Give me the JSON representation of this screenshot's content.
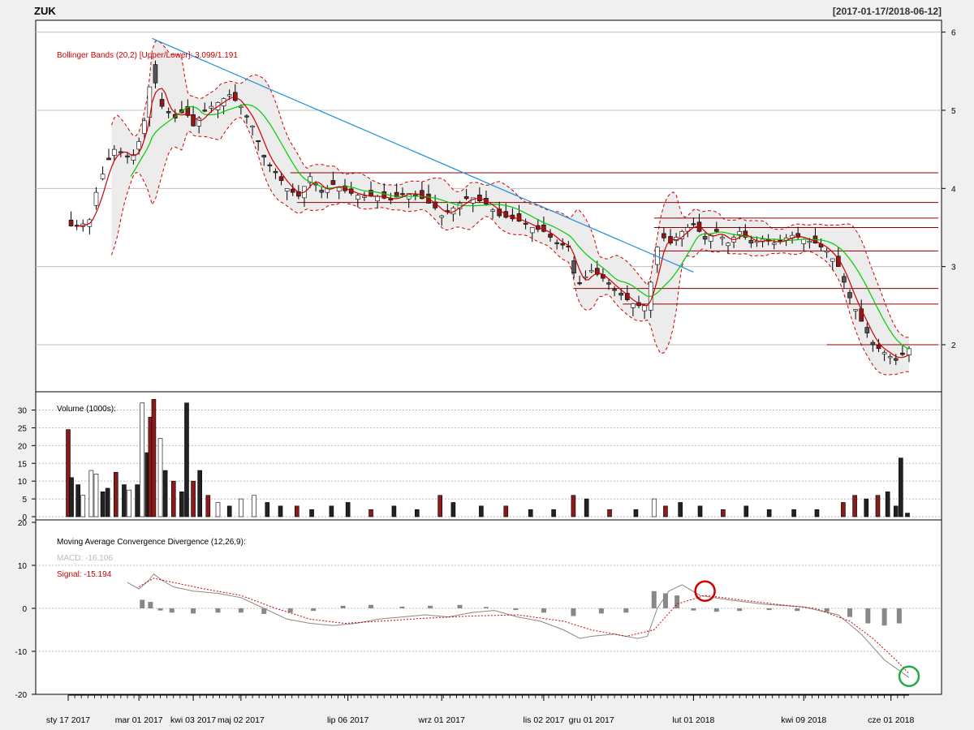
{
  "header": {
    "symbol": "ZUK",
    "date_range": "[2017-01-17/2018-06-12]"
  },
  "colors": {
    "background": "#f0f0f0",
    "panel_bg": "#ffffff",
    "border": "#000000",
    "grid": "#bfbfbf",
    "up": "#ffffff",
    "down": "#8b1a1a",
    "neutral": "#555555",
    "bband_fill": "#ececec",
    "bband_line": "#cc0000",
    "ma_fast": "#cc0000",
    "ma_slow": "#00cc00",
    "trendline": "#1e90d8",
    "support_line": "#8b0000",
    "macd_line": "#888888",
    "signal_line": "#cc0000",
    "circle_sell": "#cc0000",
    "circle_buy": "#22aa44"
  },
  "chart_data": [
    {
      "type": "candlestick",
      "panel": "price",
      "annotation": "Bollinger Bands (20,2) [Upper/Lower]: 3.099/1.191",
      "ylim": [
        1.45,
        6.1
      ],
      "yticks": [
        2,
        3,
        4,
        5,
        6
      ],
      "grid": true,
      "x_range": [
        "2017-01-17",
        "2018-06-12"
      ],
      "x_tick_labels": [
        "sty 17 2017",
        "mar 01 2017",
        "kwi 03 2017",
        "maj 02 2017",
        "lip 06 2017",
        "wrz 01 2017",
        "lis 02 2017",
        "gru 01 2017",
        "lut 01 2018",
        "kwi 09 2018",
        "cze 01 2018"
      ],
      "x_tick_dates": [
        "2017-01-17",
        "2017-03-01",
        "2017-04-03",
        "2017-05-02",
        "2017-07-06",
        "2017-09-01",
        "2017-11-02",
        "2017-12-01",
        "2018-02-01",
        "2018-04-09",
        "2018-06-01"
      ],
      "close_path": [
        [
          "2017-01-17",
          3.52
        ],
        [
          "2017-01-24",
          3.52
        ],
        [
          "2017-01-30",
          3.6
        ],
        [
          "2017-02-03",
          3.95
        ],
        [
          "2017-02-09",
          4.3
        ],
        [
          "2017-02-14",
          4.5
        ],
        [
          "2017-02-20",
          4.45
        ],
        [
          "2017-02-24",
          4.35
        ],
        [
          "2017-03-01",
          4.6
        ],
        [
          "2017-03-06",
          5.0
        ],
        [
          "2017-03-09",
          5.6
        ],
        [
          "2017-03-13",
          5.1
        ],
        [
          "2017-03-17",
          5.0
        ],
        [
          "2017-03-23",
          4.9
        ],
        [
          "2017-03-29",
          5.0
        ],
        [
          "2017-04-03",
          4.8
        ],
        [
          "2017-04-10",
          5.0
        ],
        [
          "2017-04-18",
          5.1
        ],
        [
          "2017-04-25",
          5.2
        ],
        [
          "2017-05-02",
          5.05
        ],
        [
          "2017-05-09",
          4.8
        ],
        [
          "2017-05-16",
          4.4
        ],
        [
          "2017-05-23",
          4.2
        ],
        [
          "2017-05-30",
          4.0
        ],
        [
          "2017-06-06",
          3.9
        ],
        [
          "2017-06-13",
          4.15
        ],
        [
          "2017-06-20",
          3.95
        ],
        [
          "2017-06-27",
          4.05
        ],
        [
          "2017-07-06",
          3.95
        ],
        [
          "2017-07-14",
          3.9
        ],
        [
          "2017-07-24",
          3.9
        ],
        [
          "2017-08-01",
          3.85
        ],
        [
          "2017-08-10",
          3.95
        ],
        [
          "2017-08-18",
          3.9
        ],
        [
          "2017-08-28",
          3.75
        ],
        [
          "2017-09-01",
          3.65
        ],
        [
          "2017-09-08",
          3.75
        ],
        [
          "2017-09-18",
          3.9
        ],
        [
          "2017-09-28",
          3.8
        ],
        [
          "2017-10-06",
          3.65
        ],
        [
          "2017-10-16",
          3.6
        ],
        [
          "2017-10-26",
          3.5
        ],
        [
          "2017-11-02",
          3.45
        ],
        [
          "2017-11-10",
          3.3
        ],
        [
          "2017-11-17",
          3.25
        ],
        [
          "2017-11-22",
          2.75
        ],
        [
          "2017-12-01",
          2.95
        ],
        [
          "2017-12-08",
          2.85
        ],
        [
          "2017-12-15",
          2.7
        ],
        [
          "2017-12-21",
          2.6
        ],
        [
          "2017-12-28",
          2.5
        ],
        [
          "2018-01-04",
          2.5
        ],
        [
          "2018-01-08",
          3.1
        ],
        [
          "2018-01-12",
          3.4
        ],
        [
          "2018-01-18",
          3.3
        ],
        [
          "2018-01-25",
          3.45
        ],
        [
          "2018-02-01",
          3.55
        ],
        [
          "2018-02-08",
          3.35
        ],
        [
          "2018-02-15",
          3.45
        ],
        [
          "2018-02-22",
          3.3
        ],
        [
          "2018-03-01",
          3.45
        ],
        [
          "2018-03-08",
          3.3
        ],
        [
          "2018-03-15",
          3.35
        ],
        [
          "2018-03-22",
          3.3
        ],
        [
          "2018-04-02",
          3.4
        ],
        [
          "2018-04-09",
          3.35
        ],
        [
          "2018-04-16",
          3.3
        ],
        [
          "2018-04-23",
          3.2
        ],
        [
          "2018-04-30",
          3.0
        ],
        [
          "2018-05-07",
          2.6
        ],
        [
          "2018-05-14",
          2.3
        ],
        [
          "2018-05-21",
          2.0
        ],
        [
          "2018-05-28",
          1.9
        ],
        [
          "2018-06-04",
          1.8
        ],
        [
          "2018-06-12",
          1.95
        ]
      ],
      "resistance_support_levels": [
        {
          "value": 4.2,
          "from": "2017-06-01",
          "to": "2018-06-12"
        },
        {
          "value": 3.82,
          "from": "2017-06-05",
          "to": "2018-06-12"
        },
        {
          "value": 3.62,
          "from": "2018-01-08",
          "to": "2018-06-12"
        },
        {
          "value": 3.5,
          "from": "2018-01-08",
          "to": "2018-06-12"
        },
        {
          "value": 3.2,
          "from": "2018-01-08",
          "to": "2018-06-12"
        },
        {
          "value": 2.72,
          "from": "2017-11-20",
          "to": "2018-06-12"
        },
        {
          "value": 2.52,
          "from": "2017-12-20",
          "to": "2018-06-12"
        },
        {
          "value": 2.0,
          "from": "2018-04-23",
          "to": "2018-06-12"
        }
      ],
      "trendline": {
        "from": [
          "2017-03-09",
          5.92
        ],
        "to": [
          "2018-02-01",
          2.93
        ]
      }
    },
    {
      "type": "bar",
      "panel": "volume",
      "annotation": "Volume (1000s):",
      "ylim": [
        0,
        34
      ],
      "yticks": [
        0,
        5,
        10,
        15,
        20,
        25,
        30
      ],
      "grid": true,
      "x": [
        "2017-01-17",
        "2017-01-19",
        "2017-01-23",
        "2017-01-26",
        "2017-01-31",
        "2017-02-03",
        "2017-02-07",
        "2017-02-10",
        "2017-02-15",
        "2017-02-20",
        "2017-02-23",
        "2017-02-28",
        "2017-03-03",
        "2017-03-06",
        "2017-03-08",
        "2017-03-10",
        "2017-03-14",
        "2017-03-17",
        "2017-03-22",
        "2017-03-27",
        "2017-03-30",
        "2017-04-03",
        "2017-04-07",
        "2017-04-12",
        "2017-04-18",
        "2017-04-25",
        "2017-05-02",
        "2017-05-10",
        "2017-05-18",
        "2017-05-26",
        "2017-06-05",
        "2017-06-14",
        "2017-06-26",
        "2017-07-06",
        "2017-07-20",
        "2017-08-03",
        "2017-08-17",
        "2017-08-31",
        "2017-09-08",
        "2017-09-25",
        "2017-10-10",
        "2017-10-25",
        "2017-11-08",
        "2017-11-20",
        "2017-11-28",
        "2017-12-12",
        "2017-12-28",
        "2018-01-08",
        "2018-01-15",
        "2018-01-24",
        "2018-02-05",
        "2018-02-19",
        "2018-03-05",
        "2018-03-19",
        "2018-04-03",
        "2018-04-17",
        "2018-05-03",
        "2018-05-10",
        "2018-05-17",
        "2018-05-24",
        "2018-05-30",
        "2018-06-04",
        "2018-06-07",
        "2018-06-11"
      ],
      "values": [
        24.5,
        11,
        9,
        6,
        13,
        12,
        7,
        8,
        12.5,
        9,
        7.5,
        9,
        32,
        18,
        28,
        33,
        22,
        13,
        10,
        7,
        32,
        10,
        13,
        6,
        4,
        3,
        5,
        6,
        4,
        3,
        3,
        2,
        3,
        4,
        2,
        3,
        2,
        6,
        4,
        3,
        3,
        2,
        2,
        6,
        5,
        2,
        2,
        5,
        3,
        4,
        3,
        2,
        3,
        2,
        2,
        2,
        4,
        6,
        5,
        6,
        7,
        3,
        16.5,
        1
      ],
      "colors": [
        "down",
        "neutral",
        "neutral",
        "up",
        "up",
        "up",
        "neutral",
        "neutral",
        "down",
        "neutral",
        "up",
        "neutral",
        "up",
        "neutral",
        "down",
        "down",
        "up",
        "neutral",
        "down",
        "neutral",
        "neutral",
        "down",
        "neutral",
        "down",
        "up",
        "neutral",
        "up",
        "up",
        "neutral",
        "neutral",
        "down",
        "neutral",
        "neutral",
        "neutral",
        "down",
        "neutral",
        "neutral",
        "down",
        "neutral",
        "neutral",
        "down",
        "neutral",
        "neutral",
        "down",
        "neutral",
        "down",
        "neutral",
        "up",
        "down",
        "neutral",
        "neutral",
        "down",
        "neutral",
        "neutral",
        "neutral",
        "neutral",
        "down",
        "down",
        "neutral",
        "down",
        "neutral",
        "neutral",
        "neutral",
        "neutral"
      ]
    },
    {
      "type": "line",
      "panel": "macd",
      "annotation": "Moving Average Convergence Divergence (12,26,9):",
      "macd_label": "MACD: -16.106",
      "signal_label": "Signal: -15.194",
      "ylim": [
        -20,
        20
      ],
      "yticks": [
        -20,
        -10,
        0,
        10,
        20
      ],
      "grid": true,
      "series": [
        {
          "name": "MACD",
          "points": [
            [
              "2017-02-22",
              6
            ],
            [
              "2017-03-01",
              4.5
            ],
            [
              "2017-03-07",
              6.5
            ],
            [
              "2017-03-10",
              8
            ],
            [
              "2017-03-15",
              6.5
            ],
            [
              "2017-03-22",
              5
            ],
            [
              "2017-04-03",
              4
            ],
            [
              "2017-04-18",
              3.5
            ],
            [
              "2017-05-02",
              2.5
            ],
            [
              "2017-05-16",
              0
            ],
            [
              "2017-05-30",
              -2.5
            ],
            [
              "2017-06-13",
              -3.5
            ],
            [
              "2017-06-27",
              -4
            ],
            [
              "2017-07-11",
              -3.5
            ],
            [
              "2017-07-25",
              -2.5
            ],
            [
              "2017-08-08",
              -2
            ],
            [
              "2017-08-22",
              -1.5
            ],
            [
              "2017-09-05",
              -2
            ],
            [
              "2017-09-19",
              -1
            ],
            [
              "2017-10-03",
              -0.5
            ],
            [
              "2017-10-17",
              -2
            ],
            [
              "2017-10-31",
              -3
            ],
            [
              "2017-11-14",
              -5
            ],
            [
              "2017-11-24",
              -7
            ],
            [
              "2017-12-01",
              -6.5
            ],
            [
              "2017-12-15",
              -6
            ],
            [
              "2017-12-29",
              -7
            ],
            [
              "2018-01-04",
              -6.5
            ],
            [
              "2018-01-10",
              0
            ],
            [
              "2018-01-17",
              4
            ],
            [
              "2018-01-25",
              5.5
            ],
            [
              "2018-02-05",
              3
            ],
            [
              "2018-02-22",
              2
            ],
            [
              "2018-03-15",
              1
            ],
            [
              "2018-04-09",
              0.3
            ],
            [
              "2018-04-30",
              -1.5
            ],
            [
              "2018-05-14",
              -6
            ],
            [
              "2018-05-28",
              -12
            ],
            [
              "2018-06-12",
              -16.1
            ]
          ]
        },
        {
          "name": "Signal",
          "points": [
            [
              "2017-03-01",
              5
            ],
            [
              "2017-03-10",
              7
            ],
            [
              "2017-03-22",
              6
            ],
            [
              "2017-04-10",
              4.5
            ],
            [
              "2017-05-02",
              3
            ],
            [
              "2017-05-23",
              0
            ],
            [
              "2017-06-13",
              -2.5
            ],
            [
              "2017-07-04",
              -3.5
            ],
            [
              "2017-07-25",
              -3
            ],
            [
              "2017-08-22",
              -2.3
            ],
            [
              "2017-09-19",
              -1.8
            ],
            [
              "2017-10-17",
              -1.5
            ],
            [
              "2017-11-14",
              -3
            ],
            [
              "2017-12-01",
              -5
            ],
            [
              "2017-12-22",
              -6.5
            ],
            [
              "2018-01-08",
              -5
            ],
            [
              "2018-01-22",
              1
            ],
            [
              "2018-02-08",
              3
            ],
            [
              "2018-03-01",
              2
            ],
            [
              "2018-03-22",
              1
            ],
            [
              "2018-04-16",
              0
            ],
            [
              "2018-05-07",
              -3
            ],
            [
              "2018-05-21",
              -7
            ],
            [
              "2018-06-04",
              -12
            ],
            [
              "2018-06-12",
              -15.2
            ]
          ]
        },
        {
          "name": "Histogram",
          "x": [
            "2017-03-03",
            "2017-03-08",
            "2017-03-14",
            "2017-03-21",
            "2017-04-03",
            "2017-04-18",
            "2017-05-02",
            "2017-05-16",
            "2017-06-01",
            "2017-06-15",
            "2017-07-03",
            "2017-07-20",
            "2017-08-08",
            "2017-08-25",
            "2017-09-12",
            "2017-09-28",
            "2017-10-16",
            "2017-11-02",
            "2017-11-20",
            "2017-12-07",
            "2017-12-22",
            "2018-01-08",
            "2018-01-15",
            "2018-01-22",
            "2018-02-01",
            "2018-02-15",
            "2018-03-01",
            "2018-03-19",
            "2018-04-05",
            "2018-04-23",
            "2018-05-07",
            "2018-05-18",
            "2018-05-28",
            "2018-06-06"
          ],
          "values": [
            2,
            1.5,
            -0.5,
            -1,
            -1.2,
            -1,
            -1,
            -1.3,
            -1,
            -0.6,
            0.6,
            0.8,
            0.4,
            0.6,
            0.8,
            0.3,
            -0.4,
            -1,
            -1.8,
            -1.2,
            -1,
            4,
            3.5,
            3,
            -0.5,
            -0.8,
            -0.6,
            -0.4,
            -0.6,
            -0.8,
            -2,
            -3.5,
            -4,
            -3.5
          ]
        }
      ],
      "markers": [
        {
          "kind": "sell-circle",
          "at": [
            "2018-02-08",
            4
          ]
        },
        {
          "kind": "buy-circle",
          "at": [
            "2018-06-12",
            -15.8
          ]
        }
      ]
    }
  ]
}
